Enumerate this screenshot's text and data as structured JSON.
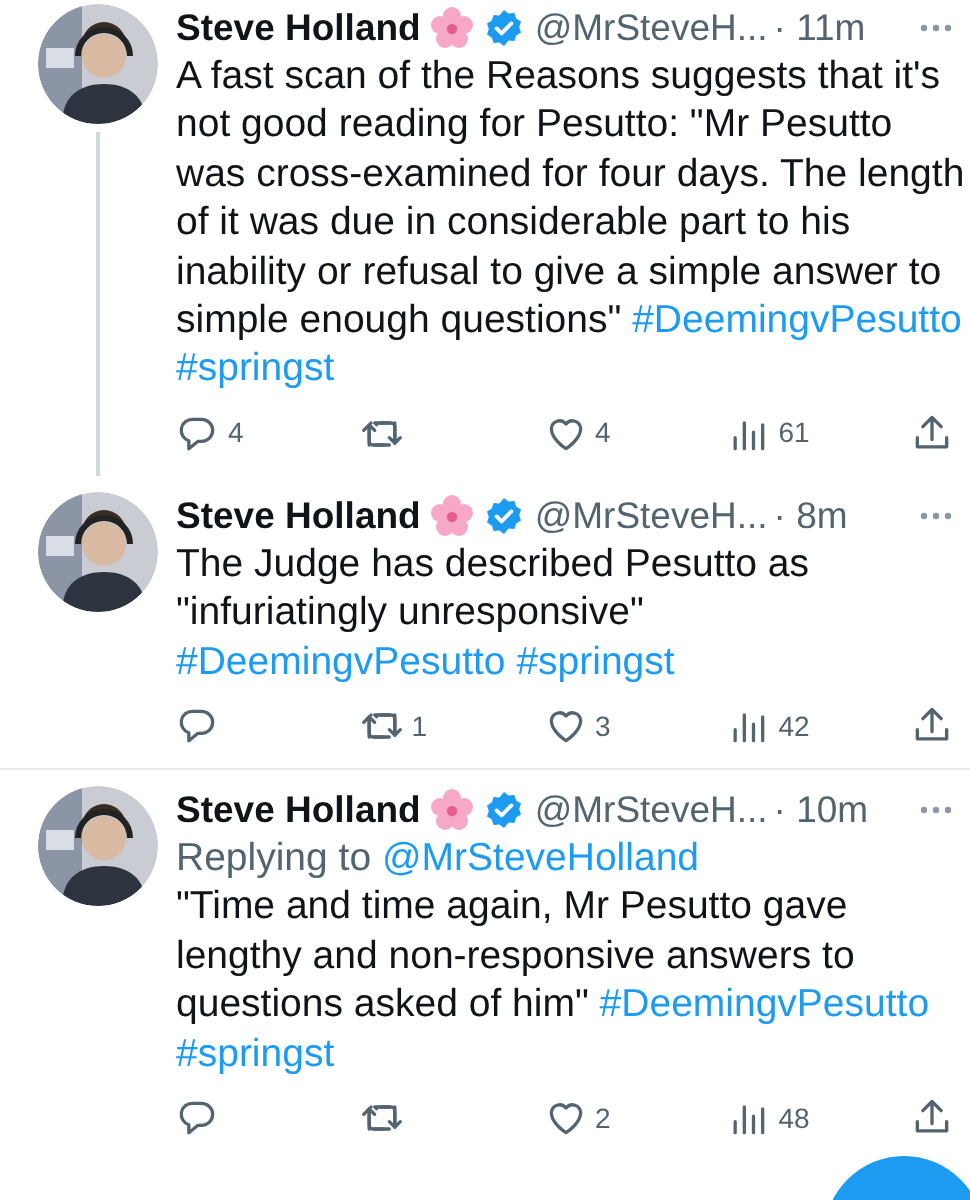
{
  "tweets": [
    {
      "name": "Steve Holland",
      "handle": "@MrSteveH...",
      "time": "· 11m",
      "thread_continues": true,
      "text": "A fast scan of the Reasons suggests that it's not good reading for Pesutto: \"Mr Pesutto was cross-examined for four days. The length of it was due in considerable part to his inability or refusal to give a simple answer to simple enough questions\"",
      "hashtags": [
        "#DeemingvPesutto",
        "#springst"
      ],
      "actions": [
        {
          "kind": "reply",
          "count": "4"
        },
        {
          "kind": "retweet"
        },
        {
          "kind": "like",
          "count": "4"
        },
        {
          "kind": "views",
          "count": "61"
        },
        {
          "kind": "share"
        }
      ]
    },
    {
      "name": "Steve Holland",
      "handle": "@MrSteveH...",
      "time": "· 8m",
      "thread_continues": false,
      "text": "The Judge has described Pesutto as \"infuriatingly unresponsive\"",
      "hashtags": [
        "#DeemingvPesutto",
        "#springst"
      ],
      "actions": [
        {
          "kind": "reply"
        },
        {
          "kind": "retweet",
          "count": "1"
        },
        {
          "kind": "like",
          "count": "3"
        },
        {
          "kind": "views",
          "count": "42"
        },
        {
          "kind": "share"
        }
      ]
    },
    {
      "name": "Steve Holland",
      "handle": "@MrSteveH...",
      "time": "· 10m",
      "thread_continues": false,
      "replying_to": {
        "label": "Replying to",
        "handle": "@MrSteveHolland"
      },
      "text": "\"Time and time again, Mr Pesutto gave lengthy and non-responsive answers to questions asked of him\"",
      "hashtags": [
        "#DeemingvPesutto",
        "#springst"
      ],
      "actions": [
        {
          "kind": "reply"
        },
        {
          "kind": "retweet"
        },
        {
          "kind": "like",
          "count": "2"
        },
        {
          "kind": "views",
          "count": "48"
        },
        {
          "kind": "share"
        }
      ]
    }
  ]
}
